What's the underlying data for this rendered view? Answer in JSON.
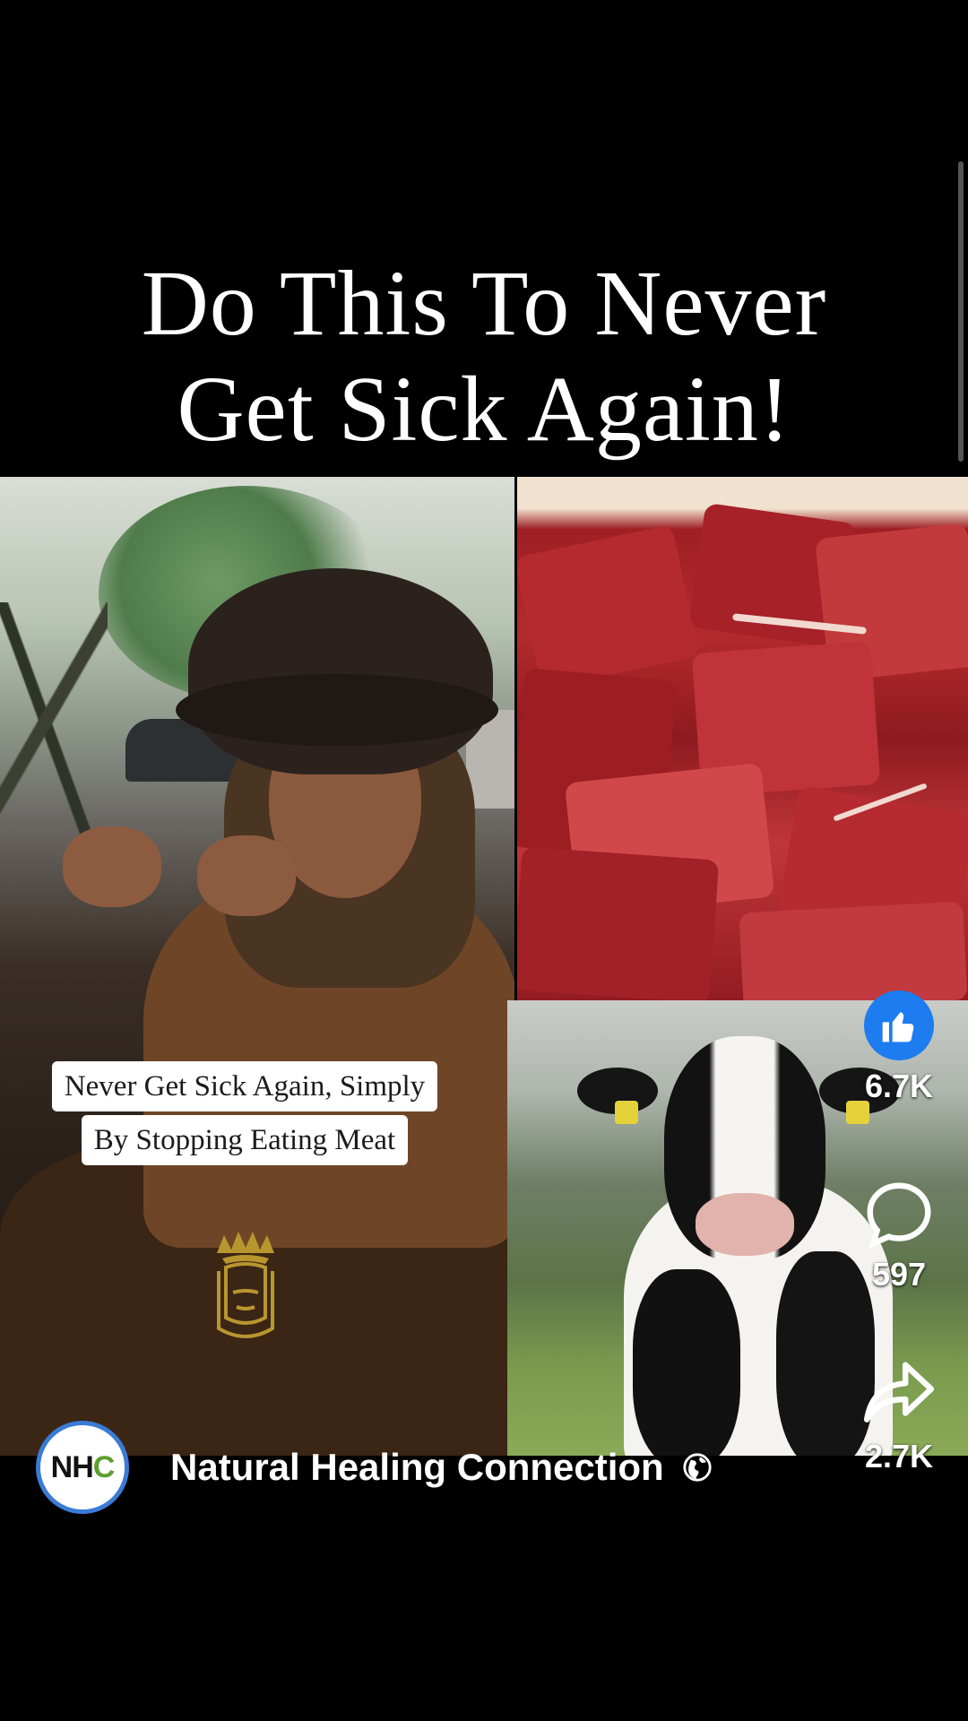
{
  "video": {
    "headline_line1": "Do This To Never",
    "headline_line2": "Get Sick Again!",
    "caption_line1": "Never Get Sick Again, Simply",
    "caption_line2": "By Stopping Eating Meat"
  },
  "actions": {
    "like_count": "6.7K",
    "comment_count": "597",
    "share_count": "2.7K"
  },
  "author": {
    "avatar_text_main": "NH",
    "avatar_text_accent": "C",
    "name": "Natural Healing Connection",
    "visibility_icon": "globe-icon"
  },
  "colors": {
    "like_blue": "#1c7cf0",
    "avatar_ring": "#3a7bd5"
  }
}
